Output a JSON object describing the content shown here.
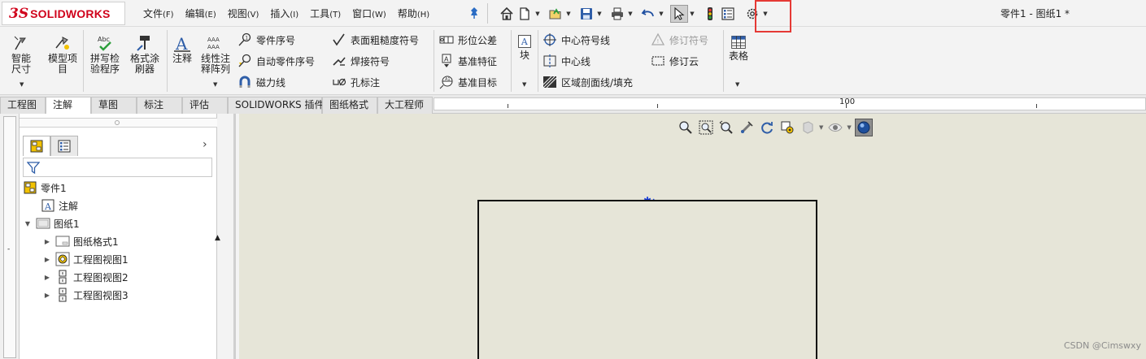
{
  "app": {
    "logo_ds": "3S",
    "logo_text": "SOLIDWORKS",
    "document_title": "零件1 - 图纸1 *"
  },
  "menu": [
    {
      "label": "文件",
      "hotkey": "(F)"
    },
    {
      "label": "编辑",
      "hotkey": "(E)"
    },
    {
      "label": "视图",
      "hotkey": "(V)"
    },
    {
      "label": "插入",
      "hotkey": "(I)"
    },
    {
      "label": "工具",
      "hotkey": "(T)"
    },
    {
      "label": "窗口",
      "hotkey": "(W)"
    },
    {
      "label": "帮助",
      "hotkey": "(H)"
    }
  ],
  "quickbar_icons": [
    "home-icon",
    "new-document-icon",
    "open-icon",
    "save-icon",
    "print-icon",
    "undo-icon",
    "select-icon",
    "rebuild-icon",
    "file-properties-icon",
    "options-gear-icon"
  ],
  "ribbon": {
    "smart_dimension": "智能尺寸",
    "model_items": "模型项目",
    "spell_checker": "拼写检验程序",
    "format_painter": "格式涂刷器",
    "note": "注释",
    "linear_note_pattern": "线性注释阵列",
    "balloon": "零件序号",
    "auto_balloon": "自动零件序号",
    "magnetic_line": "磁力线",
    "surface_finish": "表面粗糙度符号",
    "weld_symbol": "焊接符号",
    "hole_callout": "孔标注",
    "geometric_tolerance": "形位公差",
    "datum_feature": "基准特征",
    "datum_target": "基准目标",
    "blocks": "块",
    "center_mark": "中心符号线",
    "centerline": "中心线",
    "area_hatch": "区域剖面线/填充",
    "revision_symbol": "修订符号",
    "revision_cloud": "修订云",
    "tables": "表格"
  },
  "tabs": [
    {
      "label": "工程图"
    },
    {
      "label": "注解",
      "active": true
    },
    {
      "label": "草图"
    },
    {
      "label": "标注"
    },
    {
      "label": "评估"
    },
    {
      "label": "SOLIDWORKS 插件"
    },
    {
      "label": "图纸格式"
    },
    {
      "label": "大工程师"
    }
  ],
  "ruler": {
    "label": "100"
  },
  "tree": {
    "root": "零件1",
    "annotations": "注解",
    "sheet": "图纸1",
    "sheet_format": "图纸格式1",
    "views": [
      "工程图视图1",
      "工程图视图2",
      "工程图视图3"
    ]
  },
  "watermark": "CSDN @Cimswxy",
  "colors": {
    "brand_red": "#d0021b",
    "highlight_red": "#e53935",
    "graphics_bg": "#e6e5d8",
    "origin_blue": "#1a3fd8"
  }
}
